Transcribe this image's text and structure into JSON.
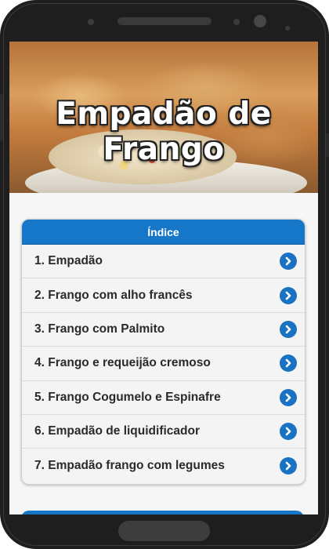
{
  "hero": {
    "title": "Empadão de Frango",
    "image": "chicken-pot-pie-photo"
  },
  "index": {
    "header": "Índice",
    "items": [
      {
        "label": "1. Empadão",
        "icon": "chevron-right-circle-icon"
      },
      {
        "label": "2. Frango com alho francês",
        "icon": "chevron-right-circle-icon"
      },
      {
        "label": "3. Frango com Palmito",
        "icon": "chevron-right-circle-icon"
      },
      {
        "label": "4. Frango e requeijão cremoso",
        "icon": "chevron-right-circle-icon"
      },
      {
        "label": "5. Frango Cogumelo e Espinafre",
        "icon": "chevron-right-circle-icon"
      },
      {
        "label": "6. Empadão de liquidificador",
        "icon": "chevron-right-circle-icon"
      },
      {
        "label": "7. Empadão frango com legumes",
        "icon": "chevron-right-circle-icon"
      }
    ]
  },
  "colors": {
    "accent": "#1677c8",
    "device": "#1e1e1e",
    "background": "#f6f6f6"
  }
}
